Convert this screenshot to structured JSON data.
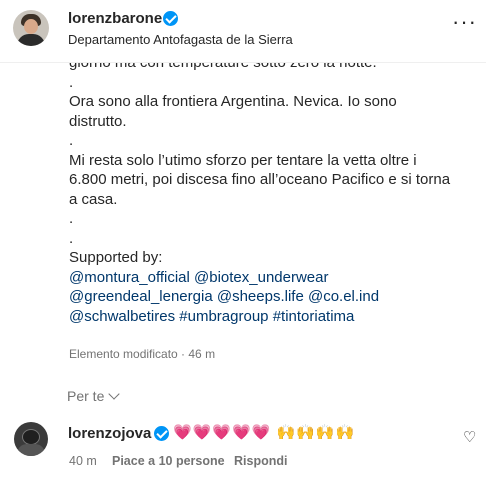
{
  "post": {
    "username": "lorenzbarone",
    "location": "Departamento Antofagasta de la Sierra",
    "more_icon": "more-horizontal-icon",
    "caption_lines": [
      "giorno ma con temperature sotto zero la notte.",
      ".",
      "Ora sono alla frontiera Argentina. Nevica. Io sono",
      "distrutto.",
      ".",
      "Mi resta solo l’utimo sforzo per tentare la vetta oltre i",
      "6.800 metri, poi discesa fino all’oceano Pacifico e si torna",
      "a casa.",
      ".",
      ".",
      "Supported by:"
    ],
    "tags_line1": [
      "@montura_official",
      "@biotex_underwear"
    ],
    "tags_line2": [
      "@greendeal_lenergia",
      "@sheeps.life",
      "@co.el.ind"
    ],
    "tags_line3": [
      "@schwalbetires",
      "#umbragroup",
      "#tintoriatima"
    ],
    "edited": "Elemento modificato · 46 m"
  },
  "filter": {
    "label": "Per te"
  },
  "comment": {
    "username": "lorenzojova",
    "emoji_hearts": "💗💗💗💗💗",
    "emoji_hands": "🙌🙌🙌🙌",
    "time": "40 m",
    "likes": "Piace a 10 persone",
    "reply": "Rispondi"
  },
  "colors": {
    "link": "#00376b",
    "verified": "#0095f6",
    "secondary_text": "#737373"
  }
}
